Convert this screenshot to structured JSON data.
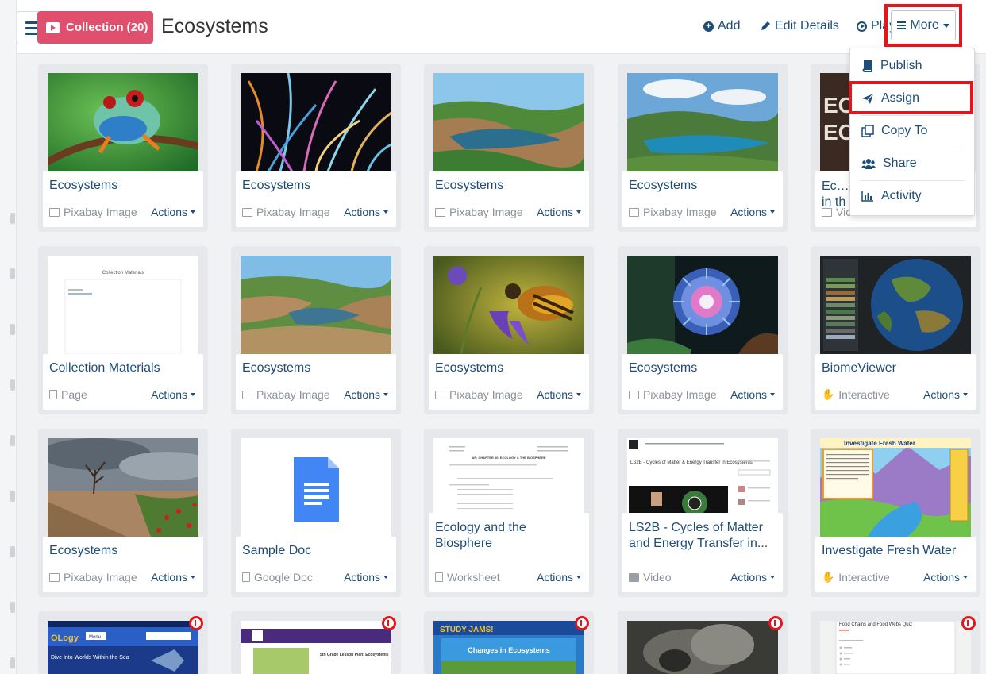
{
  "header": {
    "collection_label": "Collection (20)",
    "title": "Ecosystems",
    "add_label": "Add",
    "edit_label": "Edit Details",
    "play_label": "Play",
    "more_label": "More"
  },
  "more_menu": {
    "items": [
      {
        "label": "Publish",
        "icon": "book-icon"
      },
      {
        "label": "Assign",
        "icon": "paper-plane-icon"
      },
      {
        "label": "Copy To",
        "icon": "copy-icon"
      },
      {
        "label": "Share",
        "icon": "users-icon"
      },
      {
        "label": "Activity",
        "icon": "bar-chart-icon"
      }
    ]
  },
  "cards": [
    {
      "title": "Ecosystems",
      "type": "Pixabay Image",
      "actions": "Actions"
    },
    {
      "title": "Ecosystems",
      "type": "Pixabay Image",
      "actions": "Actions"
    },
    {
      "title": "Ecosystems",
      "type": "Pixabay Image",
      "actions": "Actions"
    },
    {
      "title": "Ecosystems",
      "type": "Pixabay Image",
      "actions": "Actions"
    },
    {
      "title": "Ecosy in th",
      "type": "Vic",
      "actions": ""
    },
    {
      "title": "Collection Materials",
      "type": "Page",
      "actions": "Actions"
    },
    {
      "title": "Ecosystems",
      "type": "Pixabay Image",
      "actions": "Actions"
    },
    {
      "title": "Ecosystems",
      "type": "Pixabay Image",
      "actions": "Actions"
    },
    {
      "title": "Ecosystems",
      "type": "Pixabay Image",
      "actions": "Actions"
    },
    {
      "title": "BiomeViewer",
      "type": "Interactive",
      "actions": "Actions"
    },
    {
      "title": "Ecosystems",
      "type": "Pixabay Image",
      "actions": "Actions"
    },
    {
      "title": "Sample Doc",
      "type": "Google Doc",
      "actions": "Actions"
    },
    {
      "title": "Ecology and the Biosphere",
      "type": "Worksheet",
      "actions": "Actions"
    },
    {
      "title": "LS2B - Cycles of Matter and Energy Transfer in...",
      "type": "Video",
      "actions": "Actions"
    },
    {
      "title": "Investigate Fresh Water",
      "type": "Interactive",
      "actions": "Actions"
    }
  ],
  "thumb_text": {
    "collection_materials": "Collection Materials",
    "worksheet_heading": "AP: CHAPTER 36: ECOLOGY & THE BIOSPHERE",
    "video_heading": "LS2B - Cycles of Matter & Energy Transfer in Ecosystems",
    "fresh_water_heading": "Investigate Fresh Water",
    "ology_brand": "OLogy",
    "ology_menu": "Menu",
    "ology_tagline": "Dive Into Worlds Within the Sea",
    "lesson_plan": "5th Grade Lesson Plan: Ecosystems",
    "studyjams_brand": "STUDY JAMS!",
    "studyjams_heading": "Changes in Ecosystems",
    "quiz_heading": "Food Chains and Food Webs Quiz"
  },
  "colors": {
    "accent_blue": "#1e4d78",
    "collection_pink": "#e04f6d",
    "highlight_red": "#e3161d"
  }
}
